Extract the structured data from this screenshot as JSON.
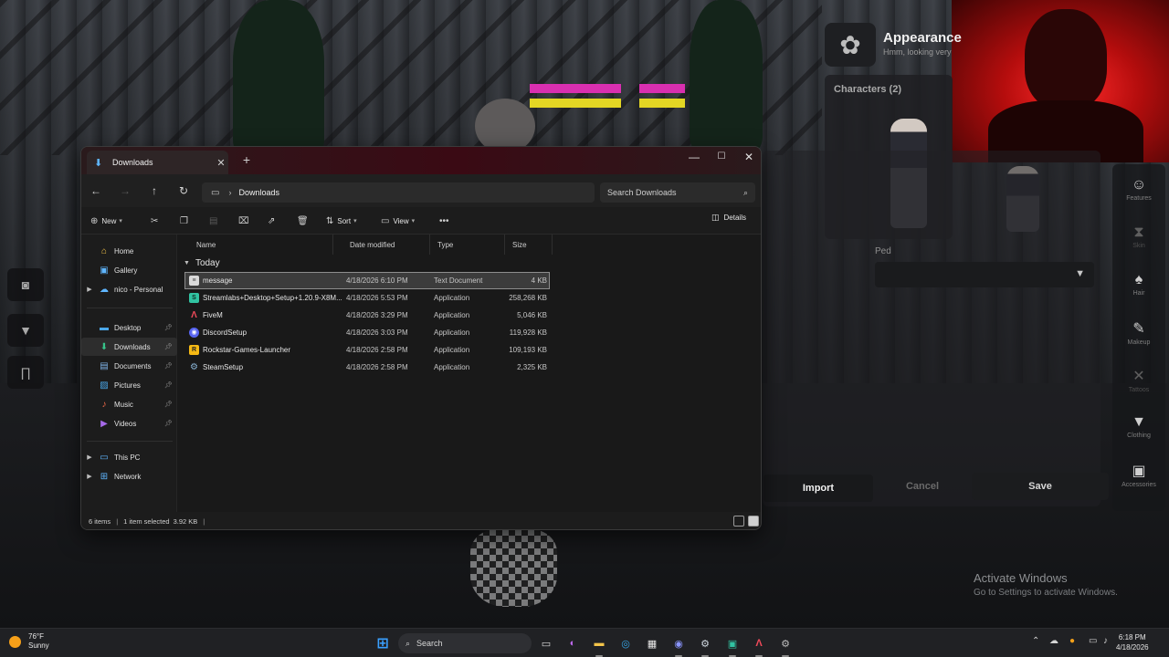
{
  "game": {
    "appearance_title": "Appearance",
    "appearance_subtitle": "Hmm, looking very",
    "characters_label": "Characters (2)",
    "ped_label": "Ped",
    "import_label": "Import",
    "cancel_label": "Cancel",
    "save_label": "Save",
    "tools": [
      {
        "label": "Features",
        "icon": "face-icon"
      },
      {
        "label": "Skin",
        "icon": "dna-icon"
      },
      {
        "label": "Hair",
        "icon": "hair-icon"
      },
      {
        "label": "Makeup",
        "icon": "brush-icon"
      },
      {
        "label": "Tattoos",
        "icon": "tattoo-icon"
      },
      {
        "label": "Clothing",
        "icon": "shirt-icon"
      },
      {
        "label": "Accessories",
        "icon": "watch-icon"
      }
    ],
    "activate_title": "Activate Windows",
    "activate_sub": "Go to Settings to activate Windows."
  },
  "explorer": {
    "tab_title": "Downloads",
    "address_path": "Downloads",
    "search_placeholder": "Search Downloads",
    "commands": {
      "new": "New",
      "sort": "Sort",
      "view": "View",
      "details": "Details"
    },
    "nav": {
      "home": "Home",
      "gallery": "Gallery",
      "onedrive": "nico - Personal",
      "desktop": "Desktop",
      "downloads": "Downloads",
      "documents": "Documents",
      "pictures": "Pictures",
      "music": "Music",
      "videos": "Videos",
      "this_pc": "This PC",
      "network": "Network"
    },
    "columns": {
      "name": "Name",
      "date": "Date modified",
      "type": "Type",
      "size": "Size"
    },
    "group": "Today",
    "files": [
      {
        "name": "message",
        "date": "4/18/2026 6:10 PM",
        "type": "Text Document",
        "size": "4 KB",
        "icon": "text-file-icon",
        "color": "#d9d9d9"
      },
      {
        "name": "Streamlabs+Desktop+Setup+1.20.9-X8M...",
        "date": "4/18/2026 5:53 PM",
        "type": "Application",
        "size": "258,268 KB",
        "icon": "streamlabs-icon",
        "color": "#31c3a2"
      },
      {
        "name": "FiveM",
        "date": "4/18/2026 3:29 PM",
        "type": "Application",
        "size": "5,046 KB",
        "icon": "fivem-icon",
        "color": "#f04a5a"
      },
      {
        "name": "DiscordSetup",
        "date": "4/18/2026 3:03 PM",
        "type": "Application",
        "size": "119,928 KB",
        "icon": "discord-icon",
        "color": "#5865f2"
      },
      {
        "name": "Rockstar-Games-Launcher",
        "date": "4/18/2026 2:58 PM",
        "type": "Application",
        "size": "109,193 KB",
        "icon": "rockstar-icon",
        "color": "#f5b914"
      },
      {
        "name": "SteamSetup",
        "date": "4/18/2026 2:58 PM",
        "type": "Application",
        "size": "2,325 KB",
        "icon": "steam-icon",
        "color": "#8ab4d6"
      }
    ],
    "status": {
      "items": "6 items",
      "selected": "1 item selected",
      "selected_size": "3.92 KB"
    }
  },
  "taskbar": {
    "weather_temp": "76°F",
    "weather_desc": "Sunny",
    "search_label": "Search",
    "time": "6:18 PM",
    "date": "4/18/2026"
  }
}
